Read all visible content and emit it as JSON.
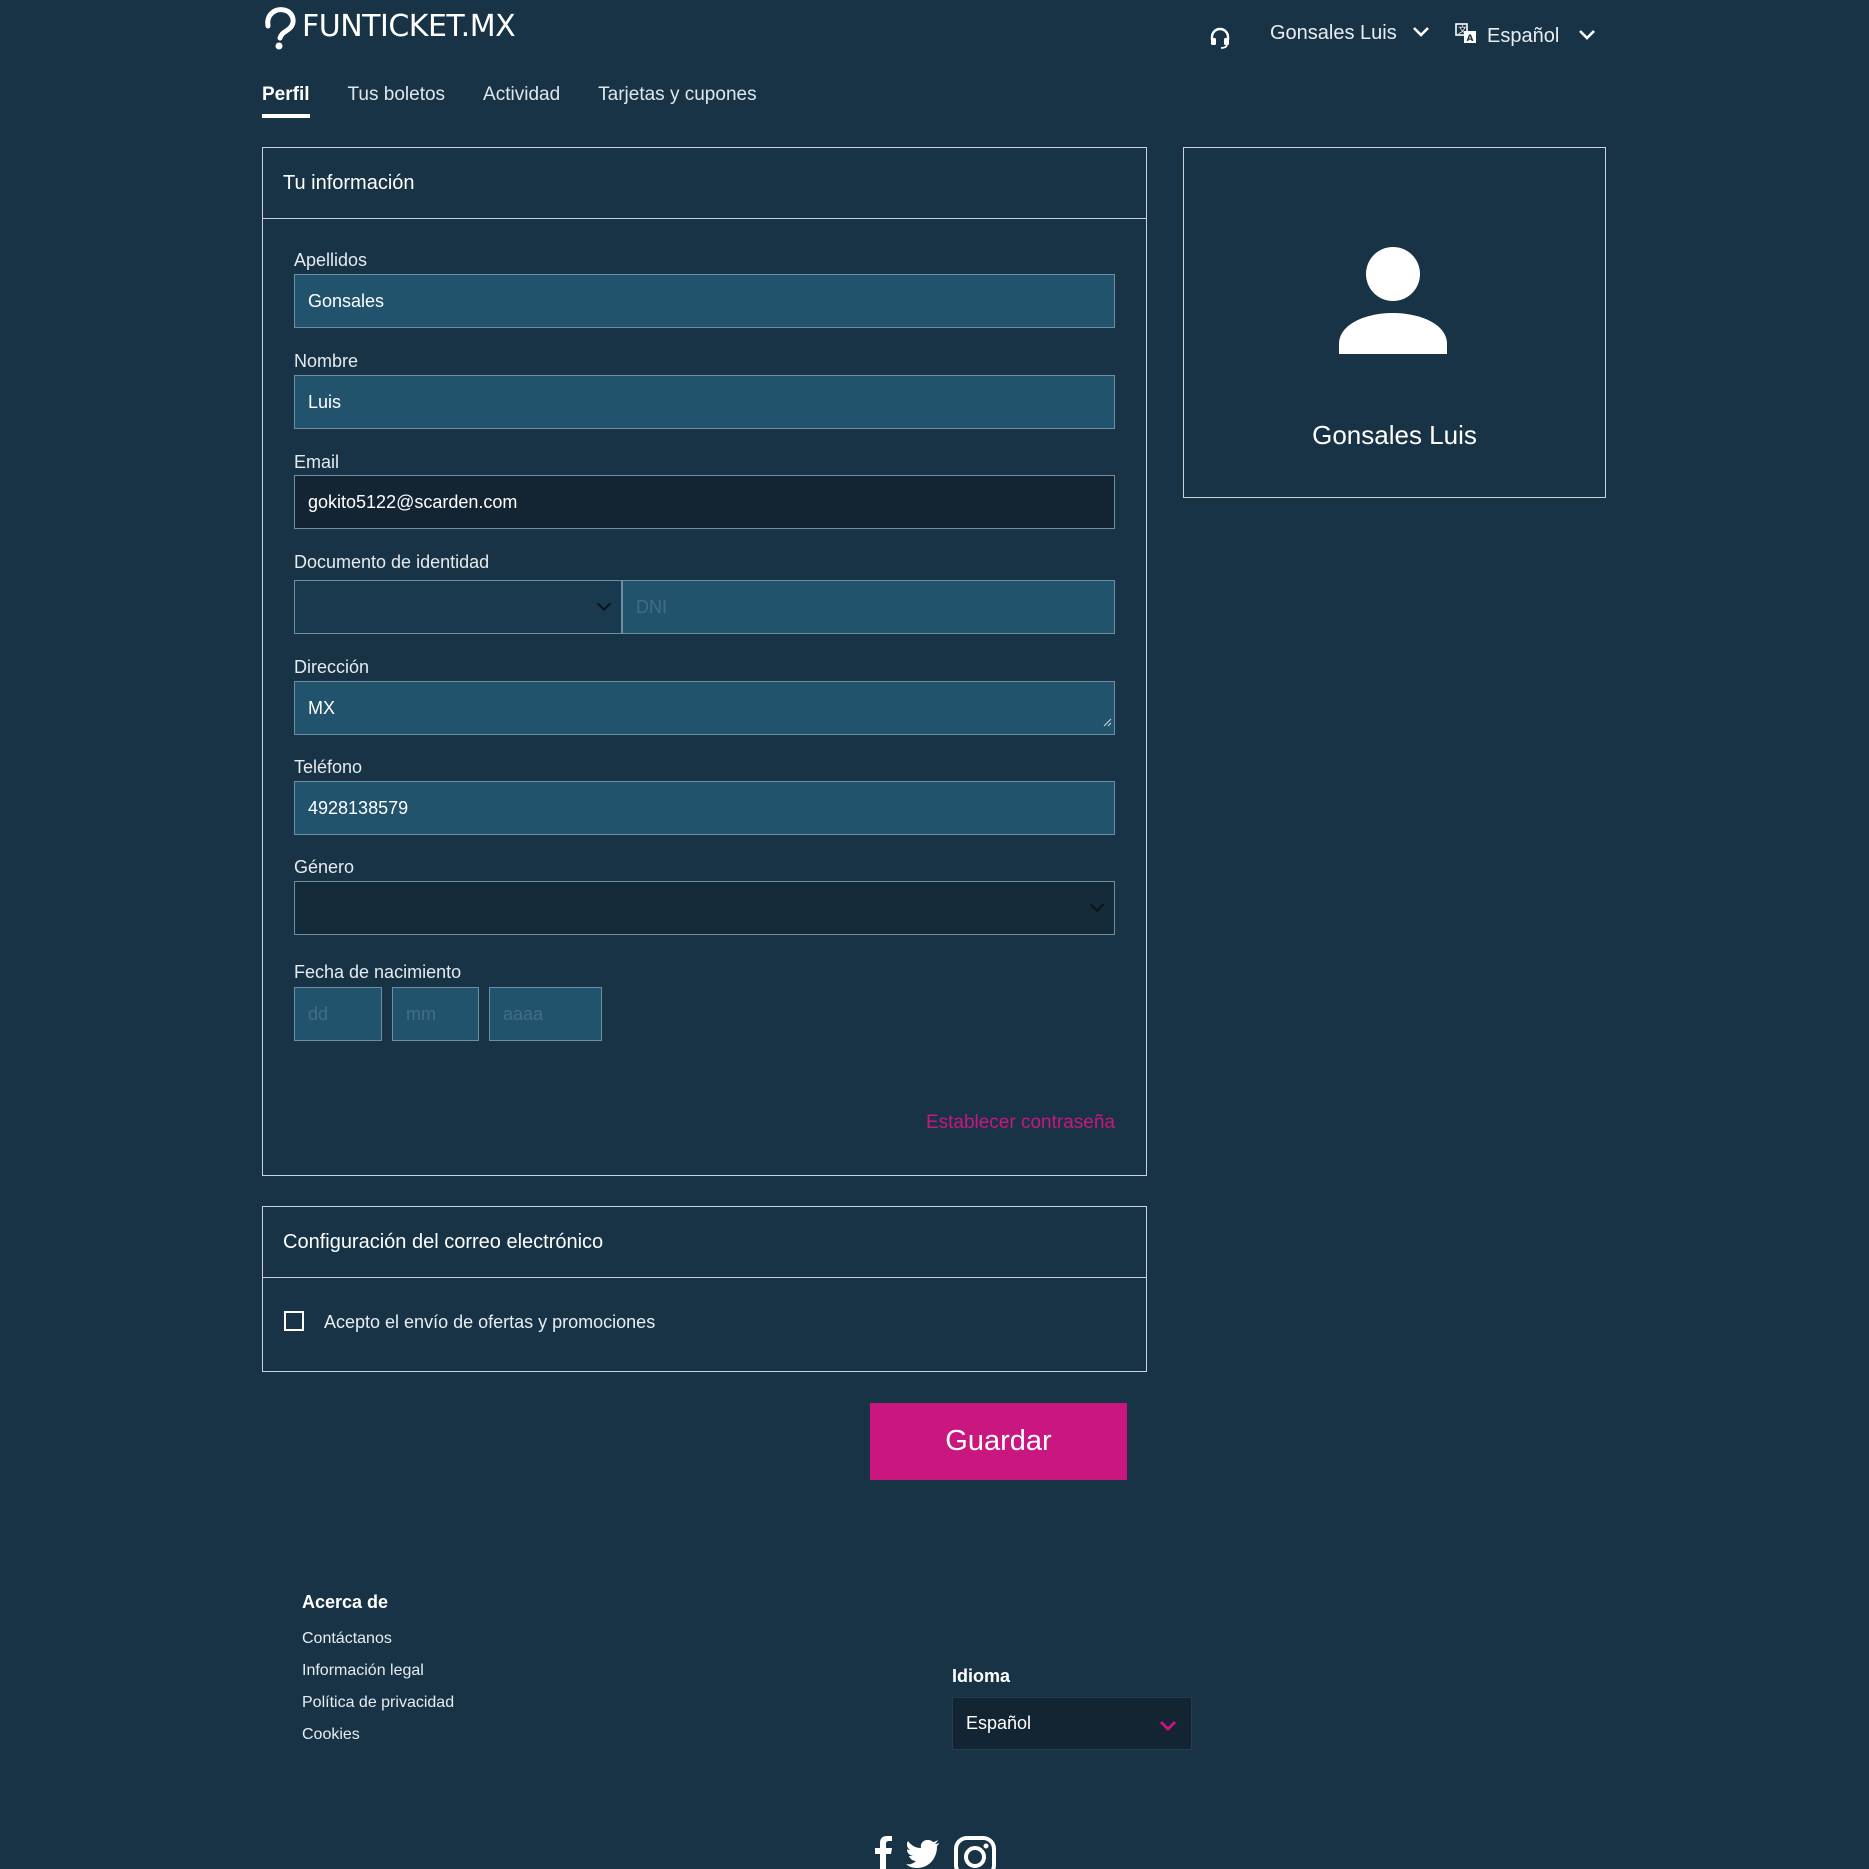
{
  "header": {
    "logo_text": "FUNTICKET.MX",
    "user_name": "Gonsales Luis",
    "language": "Español"
  },
  "tabs": [
    {
      "label": "Perfil",
      "active": true
    },
    {
      "label": "Tus boletos",
      "active": false
    },
    {
      "label": "Actividad",
      "active": false
    },
    {
      "label": "Tarjetas y cupones",
      "active": false
    }
  ],
  "info_card": {
    "title": "Tu información",
    "fields": {
      "apellidos": {
        "label": "Apellidos",
        "value": "Gonsales"
      },
      "nombre": {
        "label": "Nombre",
        "value": "Luis"
      },
      "email": {
        "label": "Email",
        "value": "gokito5122@scarden.com"
      },
      "documento": {
        "label": "Documento de identidad",
        "type_value": "",
        "placeholder": "DNI"
      },
      "direccion": {
        "label": "Dirección",
        "value": "MX"
      },
      "telefono": {
        "label": "Teléfono",
        "value": "4928138579"
      },
      "genero": {
        "label": "Género",
        "value": ""
      },
      "fecha": {
        "label": "Fecha de nacimiento",
        "dd": "dd",
        "mm": "mm",
        "aaaa": "aaaa"
      }
    },
    "set_password": "Establecer contraseña"
  },
  "email_card": {
    "title": "Configuración del correo electrónico",
    "checkbox_label": "Acepto el envío de ofertas y promociones",
    "checked": false
  },
  "save_button": "Guardar",
  "profile_card": {
    "name": "Gonsales Luis"
  },
  "footer": {
    "about_title": "Acerca de",
    "links": [
      "Contáctanos",
      "Información legal",
      "Política de privacidad",
      "Cookies"
    ],
    "language_title": "Idioma",
    "language_value": "Español"
  },
  "colors": {
    "background": "#173345",
    "accent": "#c9177f",
    "input_bg": "#22536d"
  }
}
